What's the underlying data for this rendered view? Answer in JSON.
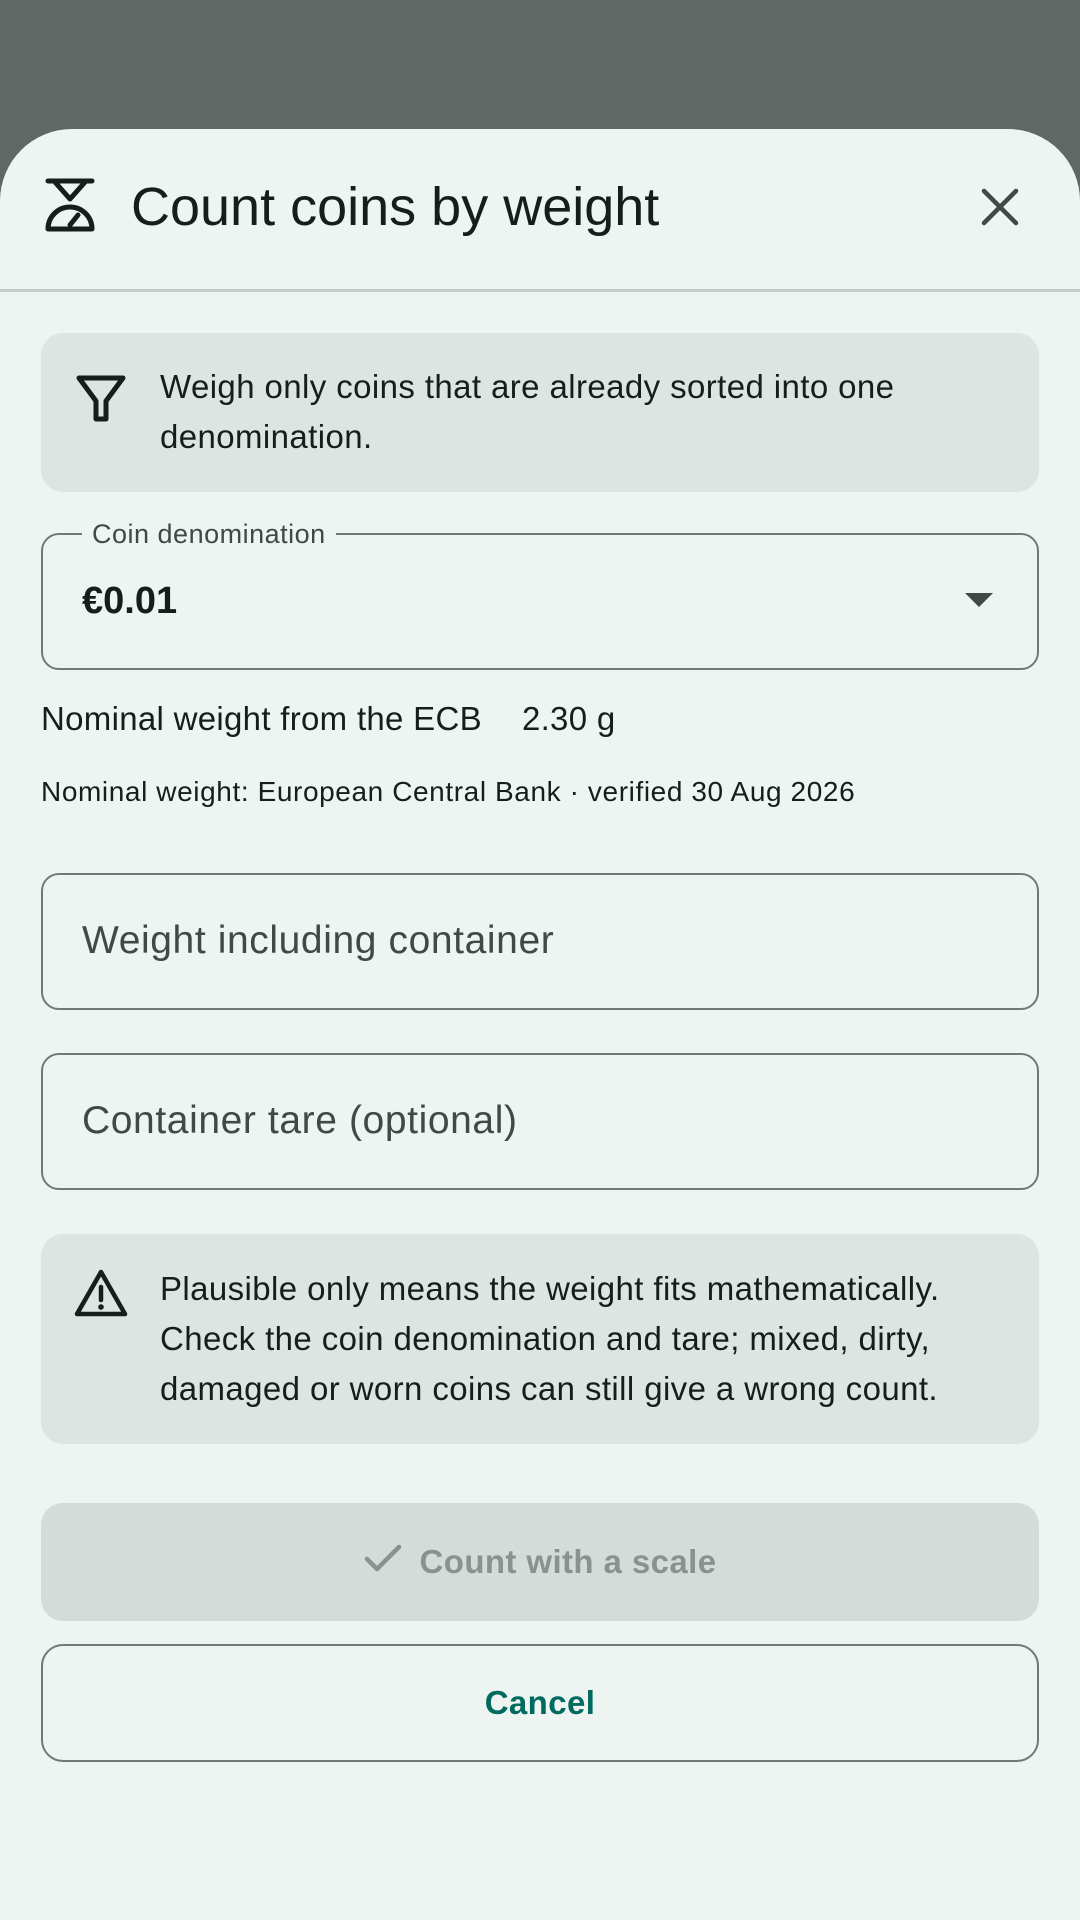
{
  "dialog": {
    "title": "Count coins by weight",
    "title_icon": "scale-icon",
    "close_icon": "close-icon"
  },
  "sorted_hint": {
    "icon": "filter-icon",
    "text": "Weigh only coins that are already sorted into one denomination."
  },
  "denomination": {
    "label": "Coin denomination",
    "value": "€0.01"
  },
  "nominal": {
    "label": "Nominal weight from the ECB",
    "value": "2.30 g",
    "source": "Nominal weight: European Central Bank · verified 30 Aug 2026"
  },
  "fields": {
    "gross_placeholder": "Weight including container",
    "tare_placeholder": "Container tare (optional)"
  },
  "warning": {
    "icon": "warning-icon",
    "text": "Plausible only means the weight fits mathematically. Check the coin denomination and tare; mixed, dirty, damaged or worn coins can still give a wrong count."
  },
  "actions": {
    "primary_label": "Count with a scale",
    "primary_enabled": false,
    "secondary_label": "Cancel"
  },
  "colors": {
    "scrim": "#606866",
    "surface": "#eef4f2",
    "card": "#dde4e1",
    "accent": "#006a5e",
    "disabled_button": "#d5dbd9"
  }
}
